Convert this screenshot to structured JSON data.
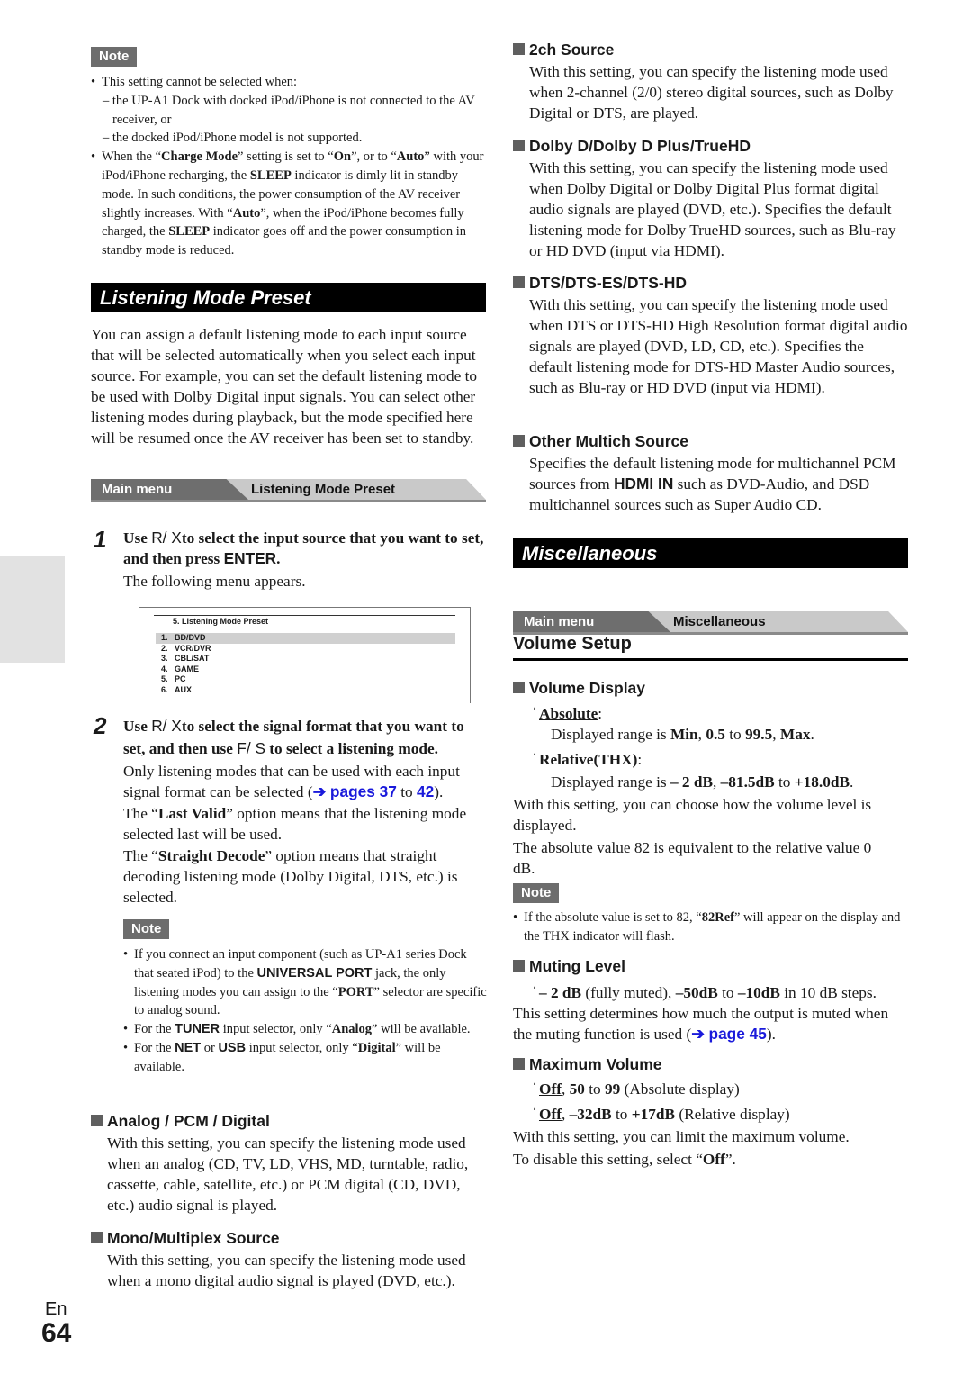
{
  "page": {
    "lang": "En",
    "number": "64"
  },
  "left": {
    "note1": {
      "badge": "Note",
      "b1": "This setting cannot be selected when:",
      "d1": "– the UP-A1 Dock with docked iPod/iPhone is not connected to the AV receiver, or",
      "d2": "– the docked iPod/iPhone model is not supported.",
      "b2": {
        "p1": "When the “",
        "charge": "Charge Mode",
        "p2": "” setting is set to “",
        "on": "On",
        "p3": "”, or to “",
        "auto": "Auto",
        "p4": "” with your iPod/iPhone recharging, the ",
        "sleep": "SLEEP",
        "p5": " indicator is dimly lit in standby mode. In such conditions, the power consumption of the AV receiver slightly increases. With “",
        "auto2": "Auto",
        "p6": "”, when the iPod/iPhone becomes fully charged, the ",
        "sleep2": "SLEEP",
        "p7": " indicator goes off and the power consumption in standby mode is reduced."
      }
    },
    "section_title": "Listening Mode Preset",
    "intro": "You can assign a default listening mode to each input source that will be selected automatically when you select each input source. For example, you can set the default listening mode to be used with Dolby Digital input signals. You can select other listening modes during playback, but the mode specified here will be resumed once the AV receiver has been set to standby.",
    "breadcrumb": {
      "main": "Main menu",
      "current": "Listening Mode Preset"
    },
    "step1": {
      "num": "1",
      "h1": "Use ",
      "keys": "R/ X",
      "h2": "to select the input source that you want to set, and then press ",
      "enter": "ENTER",
      "h3": ".",
      "body": "The following menu appears."
    },
    "menu_screen": {
      "title": "5.   Listening Mode Preset",
      "items": [
        {
          "n": "1.",
          "label": "BD/DVD",
          "selected": true
        },
        {
          "n": "2.",
          "label": "VCR/DVR"
        },
        {
          "n": "3.",
          "label": "CBL/SAT"
        },
        {
          "n": "4.",
          "label": "GAME"
        },
        {
          "n": "5.",
          "label": "PC"
        },
        {
          "n": "6.",
          "label": "AUX"
        }
      ]
    },
    "step2": {
      "num": "2",
      "h1": "Use ",
      "keys1": "R/ X",
      "h2": "to select the signal format that you want to set, and then use ",
      "keys2": "F/ S",
      "h3": " to select a listening mode.",
      "p1a": "Only listening modes that can be used with each input signal format can be selected (",
      "p1link": "➔ pages 37",
      "p1b": " to ",
      "p1link2": "42",
      "p1c": ").",
      "p2a": "The “",
      "p2b": "Last Valid",
      "p2c": "” option means that the listening mode selected last will be used.",
      "p3a": "The “",
      "p3b": "Straight Decode",
      "p3c": "” option means that straight decoding listening mode (Dolby Digital, DTS, etc.) is selected."
    },
    "note2": {
      "badge": "Note",
      "b1a": "If you connect an input component (such as UP-A1 series Dock that seated iPod) to the ",
      "b1b": "UNIVERSAL PORT",
      "b1c": " jack, the only listening modes you can assign to the “",
      "b1d": "PORT",
      "b1e": "” selector are specific to analog sound.",
      "b2a": "For the ",
      "b2b": "TUNER",
      "b2c": " input selector, only “",
      "b2d": "Analog",
      "b2e": "” will be available.",
      "b3a": "For the ",
      "b3b": "NET",
      "b3c": " or ",
      "b3d": "USB",
      "b3e": " input selector, only “",
      "b3f": "Digital",
      "b3g": "” will be available."
    },
    "analog": {
      "title": "Analog / PCM / Digital",
      "body": "With this setting, you can specify the listening mode used when an analog (CD, TV, LD, VHS, MD, turntable, radio, cassette, cable, satellite, etc.) or PCM digital (CD, DVD, etc.) audio signal is played."
    },
    "mono": {
      "title": "Mono/Multiplex Source",
      "body": "With this setting, you can specify the listening mode used when a mono digital audio signal is played (DVD, etc.)."
    }
  },
  "right": {
    "twoch": {
      "title": "2ch Source",
      "body": "With this setting, you can specify the listening mode used when 2-channel (2/0) stereo digital sources, such as Dolby Digital or DTS, are played."
    },
    "dolby": {
      "title": "Dolby D/Dolby D Plus/TrueHD",
      "body": "With this setting, you can specify the listening mode used when Dolby Digital or Dolby Digital Plus format digital audio signals are played (DVD, etc.). Specifies the default listening mode for Dolby TrueHD sources, such as Blu-ray or HD DVD (input via HDMI)."
    },
    "dts": {
      "title": "DTS/DTS-ES/DTS-HD",
      "body": "With this setting, you can specify the listening mode used when DTS or DTS-HD High Resolution format digital audio signals are played (DVD, LD, CD, etc.). Specifies the default listening mode for DTS-HD Master Audio sources, such as Blu-ray or HD DVD (input via HDMI)."
    },
    "multich": {
      "title": "Other Multich Source",
      "b1": "Specifies the default listening mode for multichannel PCM sources from ",
      "b2": "HDMI IN",
      "b3": " such as DVD-Audio, and DSD multichannel sources such as Super Audio CD."
    },
    "section_title": "Miscellaneous",
    "breadcrumb": {
      "main": "Main menu",
      "current": "Miscellaneous"
    },
    "volume_setup": "Volume Setup",
    "vol_display": {
      "title": "Volume Display",
      "opt1": "Absolute",
      "opt1_suffix": ":",
      "opt1_range": {
        "a": "Displayed range is ",
        "b": "Min",
        "c": ", ",
        "d": "0.5",
        "e": " to ",
        "f": "99.5",
        "g": ", ",
        "h": "Max",
        "i": "."
      },
      "opt2": "Relative(THX)",
      "opt2_suffix": ":",
      "opt2_range": {
        "a": "Displayed range is ",
        "b": "– 2 dB",
        "c": ", ",
        "d": "–81.5dB",
        "e": " to ",
        "f": "+18.0dB",
        "g": "."
      },
      "p1": "With this setting, you can choose how the volume level is displayed.",
      "p2": "The absolute value 82 is equivalent to the relative value 0 dB."
    },
    "note": {
      "badge": "Note",
      "a": "If the absolute value is set to 82, “",
      "b": "82Ref",
      "c": "” will appear on the display and the THX indicator will flash."
    },
    "muting": {
      "title": "Muting Level",
      "o1": "– 2 dB",
      "o2": " (fully muted), ",
      "o3": "–50dB",
      "o4": " to ",
      "o5": "–10dB",
      "o6": " in 10 dB steps.",
      "p1": "This setting determines how much the output is muted when the muting function is used (",
      "link": "➔ page 45",
      "p2": ")."
    },
    "maxvol": {
      "title": "Maximum Volume",
      "l1": {
        "off": "Off",
        "a": ", ",
        "b": "50",
        "c": " to ",
        "d": "99",
        "e": " (Absolute display)"
      },
      "l2": {
        "off": "Off",
        "a": ", ",
        "b": "–32dB",
        "c": " to ",
        "d": "+17dB",
        "e": " (Relative display)"
      },
      "p1": "With this setting, you can limit the maximum volume.",
      "p2a": "To disable this setting, select “",
      "p2b": "Off",
      "p2c": "”."
    }
  }
}
